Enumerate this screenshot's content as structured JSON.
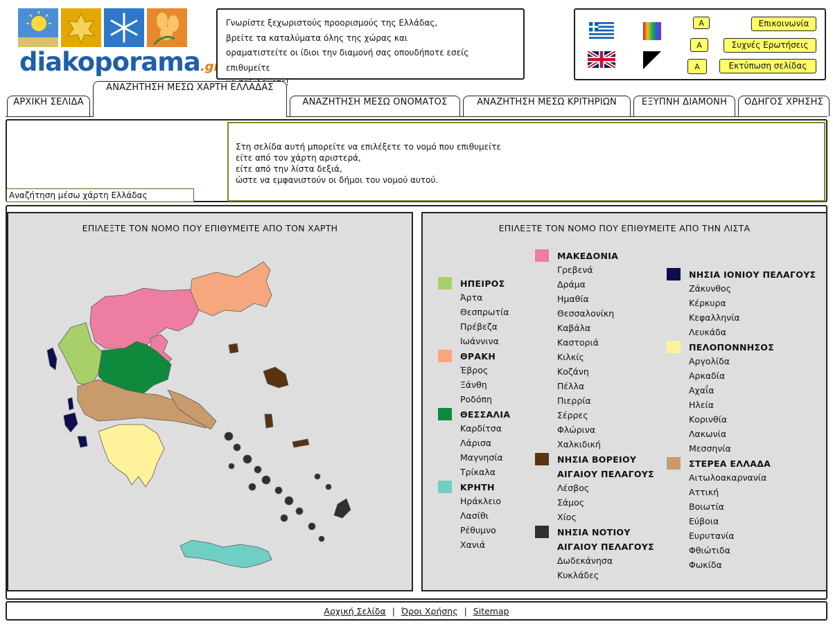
{
  "logo": {
    "text": "diakoporama",
    "suffix": ".gr"
  },
  "intro": {
    "lines": [
      "Γνωρίστε ξεχωριστούς προορισμούς της Ελλάδας,",
      "βρείτε τα καταλύματα όλης της χώρας και",
      "οραματιστείτε οι ίδιοι την διαμονή σας οπουδήποτε εσείς επιθυμείτε",
      "να ταξιδέψετε!"
    ]
  },
  "utilities": {
    "font_button": "A",
    "contact": "Επικοινωνία",
    "faq": "Συχνές Ερωτήσεις",
    "print": "Εκτύπωση σελίδας"
  },
  "tabs": [
    "ΑΡΧΙΚΗ ΣΕΛΙΔΑ",
    "ΑΝΑΖΗΤΗΣΗ ΜΕΣΩ ΧΑΡΤΗ ΕΛΛΑΔΑΣ",
    "ΑΝΑΖΗΤΗΣΗ ΜΕΣΩ ΟΝΟΜΑΤΟΣ",
    "ΑΝΑΖΗΤΗΣΗ ΜΕΣΩ ΚΡΙΤΗΡΙΩΝ",
    "ΕΞΥΠΝΗ ΔΙΑΜΟΝΗ",
    "ΟΔΗΓΟΣ ΧΡΗΣΗΣ"
  ],
  "breadcrumb": "Αναζήτηση μέσω χάρτη Ελλάδας",
  "description": [
    "Στη σελίδα αυτή μπορείτε να επιλέξετε το νομό που επιθυμείτε",
    "είτε από τον χάρτη αριστερά,",
    "είτε από την λίστα δεξιά,",
    "ώστε να εμφανιστούν οι δήμοι του νομού αυτού."
  ],
  "map_title": "ΕΠΙΛΕΞΤΕ ΤΟΝ ΝΟΜΟ ΠΟΥ ΕΠΙΘΥΜΕΙΤΕ ΑΠΟ ΤΟΝ ΧΑΡΤΗ",
  "list_title": "ΕΠΙΛΕΞΤΕ ΤΟΝ ΝΟΜΟ ΠΟΥ ΕΠΙΘΥΜΕΙΤΕ ΑΠΟ ΤΗΝ ΛΙΣΤΑ",
  "regions": {
    "ipeiros": {
      "name": "ΗΠΕΙΡΟΣ",
      "color": "#a9cf6b",
      "prefectures": [
        "Άρτα",
        "Θεσπρωτία",
        "Πρέβεζα",
        "Ιωάννινα"
      ]
    },
    "thraki": {
      "name": "ΘΡΑΚΗ",
      "color": "#f7a77d",
      "prefectures": [
        "Έβρος",
        "Ξάνθη",
        "Ροδόπη"
      ]
    },
    "thessalia": {
      "name": "ΘΕΣΣΑΛΙΑ",
      "color": "#0f8a3c",
      "prefectures": [
        "Καρδίτσα",
        "Λάρισα",
        "Μαγνησία",
        "Τρίκαλα"
      ]
    },
    "kriti": {
      "name": "ΚΡΗΤΗ",
      "color": "#6fcfc3",
      "prefectures": [
        "Ηράκλειο",
        "Λασίθι",
        "Ρέθυμνο",
        "Χανιά"
      ]
    },
    "makedonia": {
      "name": "ΜΑΚΕΔΟΝΙΑ",
      "color": "#ee7ea1",
      "prefectures": [
        "Γρεβενά",
        "Δράμα",
        "Ημαθία",
        "Θεσσαλονίκη",
        "Καβάλα",
        "Καστοριά",
        "Κιλκίς",
        "Κοζάνη",
        "Πέλλα",
        "Πιερρία",
        "Σέρρες",
        "Φλώρινα",
        "Χαλκιδική"
      ]
    },
    "voreio_aigaio": {
      "name1": "ΝΗΣΙΑ ΒΟΡΕΙΟΥ",
      "name2": "ΑΙΓΑΙΟΥ ΠΕΛΑΓΟΥΣ",
      "color": "#5a3410",
      "prefectures": [
        "Λέσβος",
        "Σάμος",
        "Χίος"
      ]
    },
    "notio_aigaio": {
      "name1": "ΝΗΣΙΑ ΝΟΤΙΟΥ",
      "name2": "ΑΙΓΑΙΟΥ ΠΕΛΑΓΟΥΣ",
      "color": "#2f2f2f",
      "prefectures": [
        "Δωδεκάνησα",
        "Κυκλάδες"
      ]
    },
    "ionio": {
      "name": "ΝΗΣΙΑ ΙΟΝΙΟΥ ΠΕΛΑΓΟΥΣ",
      "color": "#0d0d4f",
      "prefectures": [
        "Ζάκυνθος",
        "Κέρκυρα",
        "Κεφαλληνία",
        "Λευκάδα"
      ]
    },
    "peloponnisos": {
      "name": "ΠΕΛΟΠΟΝΝΗΣΟΣ",
      "color": "#fff29a",
      "prefectures": [
        "Αργολίδα",
        "Αρκαδία",
        "Αχαΐα",
        "Ηλεία",
        "Κορινθία",
        "Λακωνία",
        "Μεσσηνία"
      ]
    },
    "sterea": {
      "name": "ΣΤΕΡΕΑ ΕΛΛΑΔΑ",
      "color": "#c99a6c",
      "prefectures": [
        "Αιτωλοακαρνανία",
        "Αττική",
        "Βοιωτία",
        "Εύβοια",
        "Ευρυτανία",
        "Φθιώτιδα",
        "Φωκίδα"
      ]
    }
  },
  "footer": {
    "home": "Αρχική Σελίδα",
    "terms": "Όροι Χρήσης",
    "sitemap": "Sitemap"
  }
}
